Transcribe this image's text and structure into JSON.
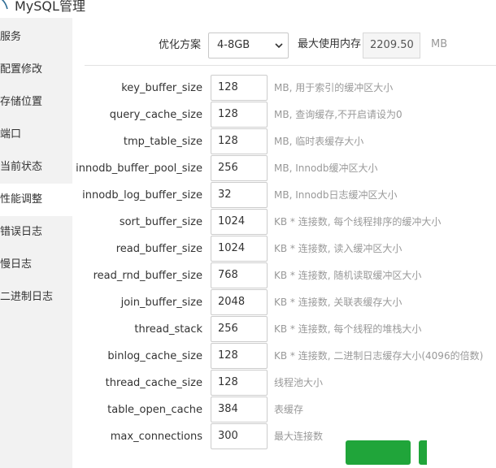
{
  "window": {
    "title": "MySQL管理"
  },
  "sidebar": {
    "items": [
      {
        "label": "服务"
      },
      {
        "label": "配置修改"
      },
      {
        "label": "存储位置"
      },
      {
        "label": "端口"
      },
      {
        "label": "当前状态"
      },
      {
        "label": "性能调整",
        "active": true
      },
      {
        "label": "错误日志"
      },
      {
        "label": "慢日志"
      },
      {
        "label": "二进制日志"
      }
    ]
  },
  "optimize": {
    "scheme_label": "优化方案",
    "scheme_value": "4-8GB",
    "max_mem_label": "最大使用内存",
    "max_mem_value": "2209.50",
    "max_mem_unit": "MB"
  },
  "params": [
    {
      "name": "key_buffer_size",
      "value": "128",
      "desc": "MB, 用于索引的缓冲区大小"
    },
    {
      "name": "query_cache_size",
      "value": "128",
      "desc": "MB, 查询缓存,不开启请设为0"
    },
    {
      "name": "tmp_table_size",
      "value": "128",
      "desc": "MB, 临时表缓存大小"
    },
    {
      "name": "innodb_buffer_pool_size",
      "value": "256",
      "desc": "MB, Innodb缓冲区大小"
    },
    {
      "name": "innodb_log_buffer_size",
      "value": "32",
      "desc": "MB, Innodb日志缓冲区大小"
    },
    {
      "name": "sort_buffer_size",
      "value": "1024",
      "desc": "KB * 连接数, 每个线程排序的缓冲大小"
    },
    {
      "name": "read_buffer_size",
      "value": "1024",
      "desc": "KB * 连接数, 读入缓冲区大小"
    },
    {
      "name": "read_rnd_buffer_size",
      "value": "768",
      "desc": "KB * 连接数, 随机读取缓冲区大小"
    },
    {
      "name": "join_buffer_size",
      "value": "2048",
      "desc": "KB * 连接数, 关联表缓存大小"
    },
    {
      "name": "thread_stack",
      "value": "256",
      "desc": "KB * 连接数, 每个线程的堆栈大小"
    },
    {
      "name": "binlog_cache_size",
      "value": "128",
      "desc": "KB * 连接数, 二进制日志缓存大小(4096的倍数)"
    },
    {
      "name": "thread_cache_size",
      "value": "128",
      "desc": "线程池大小"
    },
    {
      "name": "table_open_cache",
      "value": "384",
      "desc": "表缓存"
    },
    {
      "name": "max_connections",
      "value": "300",
      "desc": "最大连接数"
    }
  ],
  "colors": {
    "accent": "#20a53a",
    "sidebar_bg": "#f2f2f2"
  },
  "icons": {
    "app": "mysql-icon",
    "select": "chevron-down-icon"
  }
}
